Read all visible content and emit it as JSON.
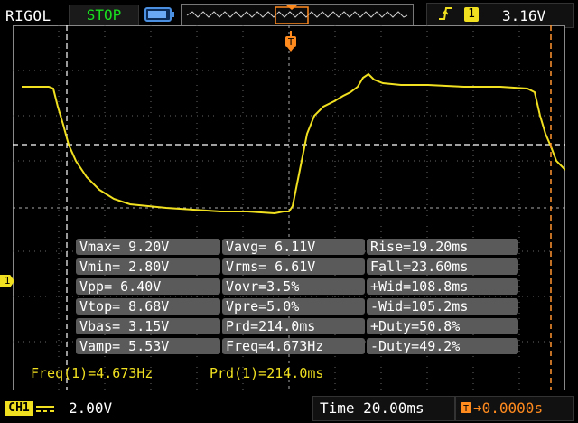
{
  "header": {
    "brand": "RIGOL",
    "run_status": "STOP",
    "trigger_source": "1",
    "trigger_level": "3.16V",
    "status_color": "#19e01f",
    "channel_color": "#f0e020",
    "trigger_color": "#ff8a1e"
  },
  "measurements": [
    [
      "Vmax= 9.20V",
      "Vavg= 6.11V",
      "Rise=19.20ms"
    ],
    [
      "Vmin= 2.80V",
      "Vrms= 6.61V",
      "Fall=23.60ms"
    ],
    [
      "Vpp= 6.40V",
      "Vovr=3.5%",
      "+Wid=108.8ms"
    ],
    [
      "Vtop= 8.68V",
      "Vpre=5.0%",
      "-Wid=105.2ms"
    ],
    [
      "Vbas= 3.15V",
      "Prd=214.0ms",
      "+Duty=50.8%"
    ],
    [
      "Vamp= 5.53V",
      "Freq=4.673Hz",
      "-Duty=49.2%"
    ]
  ],
  "cursor_readout": {
    "freq": "Freq(1)=4.673Hz",
    "period": "Prd(1)=214.0ms"
  },
  "footer": {
    "channel": "CH1",
    "volts_per_div": "2.00V",
    "timebase": "Time 20.00ms",
    "trigger_position": "0.0000s"
  },
  "markers": {
    "ground_channel": "1",
    "trigger": "T"
  },
  "icons": {
    "edge": "rising-edge-icon",
    "battery": "battery-icon",
    "coupling": "dc-coupling-icon"
  }
}
